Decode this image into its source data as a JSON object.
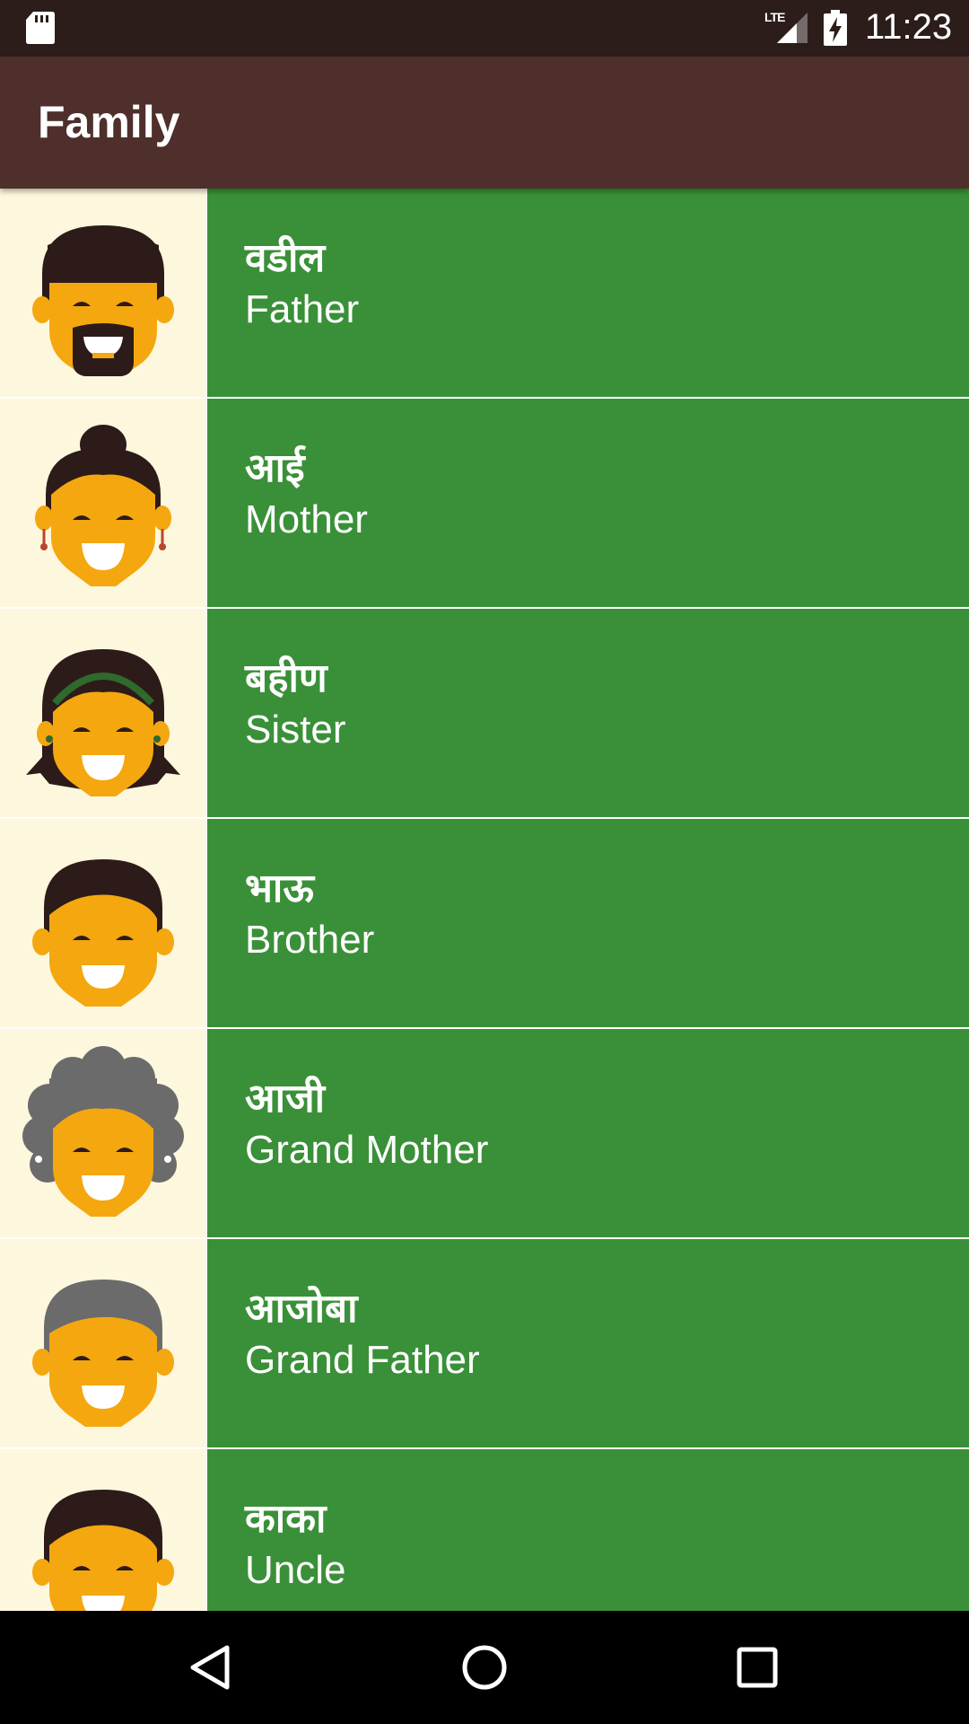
{
  "status_bar": {
    "network": "LTE",
    "time": "11:23"
  },
  "app_bar": {
    "title": "Family"
  },
  "items": [
    {
      "native": "वडील",
      "english": "Father",
      "avatar": "father-avatar-icon"
    },
    {
      "native": "आई",
      "english": "Mother",
      "avatar": "mother-avatar-icon"
    },
    {
      "native": "बहीण",
      "english": "Sister",
      "avatar": "sister-avatar-icon"
    },
    {
      "native": "भाऊ",
      "english": "Brother",
      "avatar": "brother-avatar-icon"
    },
    {
      "native": "आजी",
      "english": "Grand Mother",
      "avatar": "grandmother-avatar-icon"
    },
    {
      "native": "आजोबा",
      "english": "Grand Father",
      "avatar": "grandfather-avatar-icon"
    },
    {
      "native": "काका",
      "english": "Uncle",
      "avatar": "uncle-avatar-icon"
    }
  ],
  "colors": {
    "status_bar": "#2c1d1b",
    "app_bar": "#4e2f2b",
    "item_background": "#3a9038",
    "image_background": "#fdf7dd",
    "face": "#f4a70f",
    "hair_dark": "#2d1b19",
    "hair_gray": "#6b6b6b"
  }
}
